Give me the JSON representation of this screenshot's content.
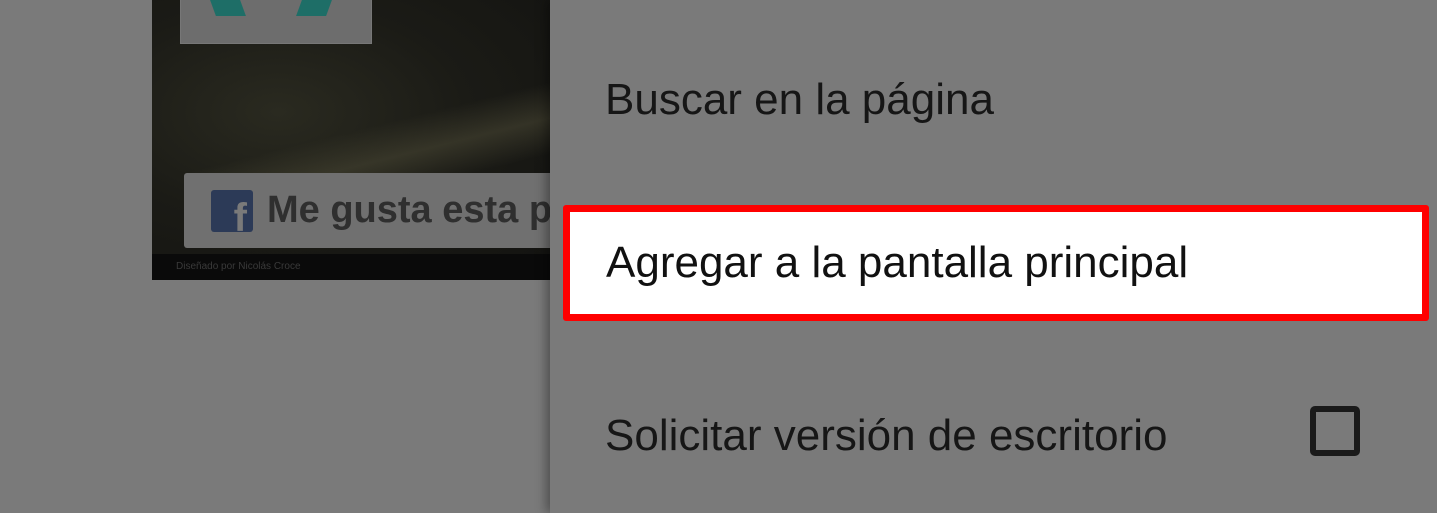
{
  "background_page": {
    "facebook_like_text": "Me gusta esta p",
    "designer_credit": "Diseñado por Nicolás Croce"
  },
  "menu": {
    "items": [
      {
        "label": "Buscar en la página"
      },
      {
        "label": "Agregar a la pantalla principal",
        "highlighted": true
      },
      {
        "label": "Solicitar versión de escritorio",
        "checkbox_checked": false
      }
    ]
  },
  "colors": {
    "highlight_border": "#ff0000",
    "menu_background": "#7a7a7a",
    "highlight_fill": "#ffffff"
  },
  "icons": {
    "facebook": "facebook-icon",
    "checkbox": "checkbox-icon"
  }
}
